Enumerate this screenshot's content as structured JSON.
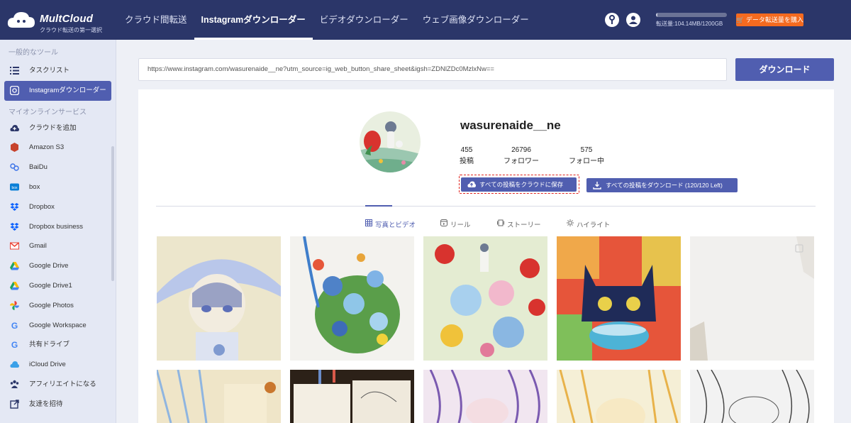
{
  "brand": {
    "name": "MultCloud",
    "tagline": "クラウド転送の第一選択"
  },
  "nav": {
    "items": [
      {
        "label": "クラウド間転送",
        "active": false
      },
      {
        "label": "Instagramダウンローダー",
        "active": true
      },
      {
        "label": "ビデオダウンローダー",
        "active": false
      },
      {
        "label": "ウェブ画像ダウンローダー",
        "active": false
      }
    ]
  },
  "topbar": {
    "icons": [
      "key-icon",
      "user-icon"
    ],
    "usage_text": "転送量:104.14MB/1200GB",
    "usage_fraction": 0.0001,
    "buy_label": "データ転送量を購入"
  },
  "sidebar": {
    "general_title": "一般的なツール",
    "general_items": [
      {
        "label": "タスクリスト",
        "icon": "task-list-icon"
      },
      {
        "label": "Instagramダウンローダー",
        "icon": "instagram-icon",
        "active": true
      }
    ],
    "services_title": "マイオンラインサービス",
    "services": [
      {
        "label": "クラウドを追加",
        "icon": "add-cloud-icon",
        "color": "#2b3669"
      },
      {
        "label": "Amazon S3",
        "icon": "amazon-s3-icon",
        "color": "#c7422c"
      },
      {
        "label": "BaiDu",
        "icon": "baidu-icon",
        "color": "#3a72e8"
      },
      {
        "label": "box",
        "icon": "box-icon",
        "color": "#0a7fd7"
      },
      {
        "label": "Dropbox",
        "icon": "dropbox-icon",
        "color": "#0b61fe"
      },
      {
        "label": "Dropbox business",
        "icon": "dropbox-business-icon",
        "color": "#0b61fe"
      },
      {
        "label": "Gmail",
        "icon": "gmail-icon",
        "color": "#ea4335"
      },
      {
        "label": "Google Drive",
        "icon": "google-drive-icon",
        "color": "#1fa463"
      },
      {
        "label": "Google Drive1",
        "icon": "google-drive-icon",
        "color": "#1fa463"
      },
      {
        "label": "Google Photos",
        "icon": "google-photos-icon",
        "color": "#fbbc04"
      },
      {
        "label": "Google Workspace",
        "icon": "google-workspace-icon",
        "color": "#4285f4"
      },
      {
        "label": "共有ドライブ",
        "icon": "shared-drive-icon",
        "color": "#4285f4"
      },
      {
        "label": "iCloud Drive",
        "icon": "icloud-icon",
        "color": "#3aa0e8"
      },
      {
        "label": "アフィリエイトになる",
        "icon": "affiliate-icon",
        "color": "#2b3669"
      },
      {
        "label": "友達を招待",
        "icon": "invite-icon",
        "color": "#2b3669"
      }
    ]
  },
  "search": {
    "url": "https://www.instagram.com/wasurenaide__ne?utm_source=ig_web_button_share_sheet&igsh=ZDNlZDc0MzlxNw==",
    "download_label": "ダウンロード"
  },
  "profile": {
    "username": "wasurenaide__ne",
    "stats": [
      {
        "value": "455",
        "label": "投稿"
      },
      {
        "value": "26796",
        "label": "フォロワー"
      },
      {
        "value": "575",
        "label": "フォロー中"
      }
    ],
    "save_cloud_label": "すべての投稿をクラウドに保存",
    "download_all_label": "すべての投稿をダウンロード (120/120 Left)"
  },
  "tabs": [
    {
      "label": "写真とビデオ",
      "icon": "grid-icon",
      "active": true
    },
    {
      "label": "リール",
      "icon": "reel-icon",
      "active": false
    },
    {
      "label": "ストーリー",
      "icon": "story-icon",
      "active": false
    },
    {
      "label": "ハイライト",
      "icon": "highlight-icon",
      "active": false
    }
  ],
  "colors": {
    "topbar": "#2b3669",
    "accent": "#505eb0",
    "buy": "#f56a1f",
    "highlight_border": "#e0241f"
  }
}
